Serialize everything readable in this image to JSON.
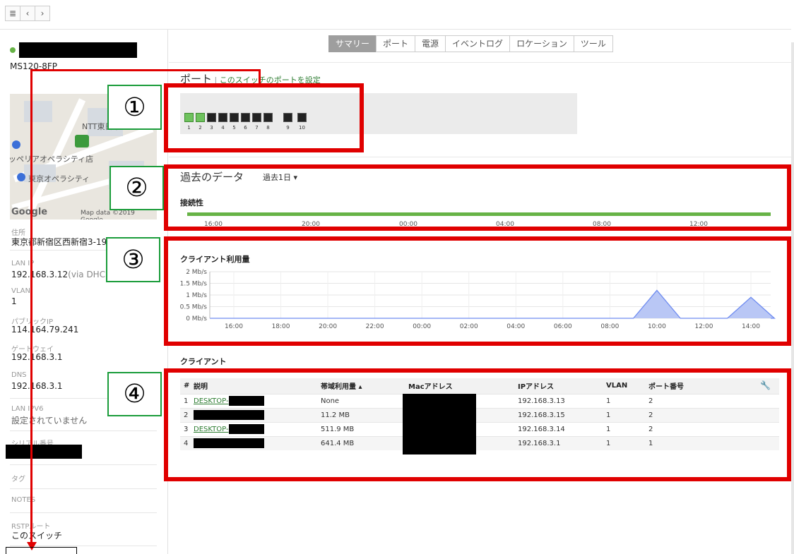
{
  "nav": {
    "menu_icon": "menu-icon",
    "back_icon": "chevron-left-icon",
    "forward_icon": "chevron-right-icon"
  },
  "sidebar": {
    "model": "MS120-8FP",
    "map": {
      "label_ntt": "NTT東日本",
      "label_store": "ッペリアオペラシティ店",
      "label_opera": "東京オペラシティ",
      "google": "Google",
      "attribution": "Map data ©2019 Google"
    },
    "fields": [
      {
        "label": "住所",
        "value": "東京都新宿区西新宿3-19-"
      },
      {
        "label": "LAN IP",
        "value": "192.168.3.12",
        "suffix": "(via DHCP)"
      },
      {
        "label": "VLAN",
        "value": "1"
      },
      {
        "label": "パブリックIP",
        "value": "114.164.79.241"
      },
      {
        "label": "ゲートウェイ",
        "value": "192.168.3.1"
      },
      {
        "label": "DNS",
        "value": "192.168.3.1"
      },
      {
        "label": "LAN IPV6",
        "value": "設定されていません"
      },
      {
        "label": "シリアル番号",
        "value": ""
      },
      {
        "label": "タグ",
        "value": ""
      },
      {
        "label": "NOTES",
        "value": ""
      },
      {
        "label": "RSTPルート",
        "value": "このスイッチ"
      }
    ]
  },
  "tabs": [
    "サマリー",
    "ポート",
    "電源",
    "イベントログ",
    "ロケーション",
    "ツール"
  ],
  "ports": {
    "title": "ポート",
    "link": "このスイッチのポートを設定",
    "numbers": [
      "1",
      "2",
      "3",
      "4",
      "5",
      "6",
      "7",
      "8",
      "9",
      "10"
    ]
  },
  "history": {
    "title": "過去のデータ",
    "range": "過去1日 ▾",
    "connectivity_label": "接続性",
    "times": [
      "16:00",
      "20:00",
      "00:00",
      "04:00",
      "08:00",
      "12:00"
    ]
  },
  "chart_data": {
    "type": "area",
    "title": "クライアント利用量",
    "y_ticks": [
      "2 Mb/s",
      "1.5 Mb/s",
      "1 Mb/s",
      "0.5 Mb/s",
      "0 Mb/s"
    ],
    "ylim": [
      0,
      2
    ],
    "x": [
      "16:00",
      "18:00",
      "20:00",
      "22:00",
      "00:00",
      "02:00",
      "04:00",
      "06:00",
      "08:00",
      "10:00",
      "12:00",
      "14:00"
    ],
    "values": [
      0,
      0,
      0,
      0,
      0,
      0,
      0,
      0,
      0,
      1.2,
      0,
      0.9
    ]
  },
  "clients": {
    "title": "クライアント",
    "headers": [
      "#",
      "説明",
      "帯域利用量 ▴",
      "Macアドレス",
      "IPアドレス",
      "VLAN",
      "ポート番号"
    ],
    "rows": [
      {
        "n": "1",
        "desc": "DESKTOP-",
        "usage": "None",
        "ip": "192.168.3.13",
        "vlan": "1",
        "port": "2"
      },
      {
        "n": "2",
        "desc": "",
        "usage": "11.2 MB",
        "ip": "192.168.3.15",
        "vlan": "1",
        "port": "2"
      },
      {
        "n": "3",
        "desc": "DESKTOP-",
        "usage": "511.9 MB",
        "ip": "192.168.3.14",
        "vlan": "1",
        "port": "2"
      },
      {
        "n": "4",
        "desc": "",
        "usage": "641.4 MB",
        "ip": "192.168.3.1",
        "vlan": "1",
        "port": "1"
      }
    ]
  },
  "annotations": [
    "①",
    "②",
    "③",
    "④"
  ],
  "colors": {
    "accent_green": "#67b346",
    "highlight_red": "#e00000",
    "chart_fill": "#b9c7f5",
    "chart_line": "#6f8cf0"
  }
}
